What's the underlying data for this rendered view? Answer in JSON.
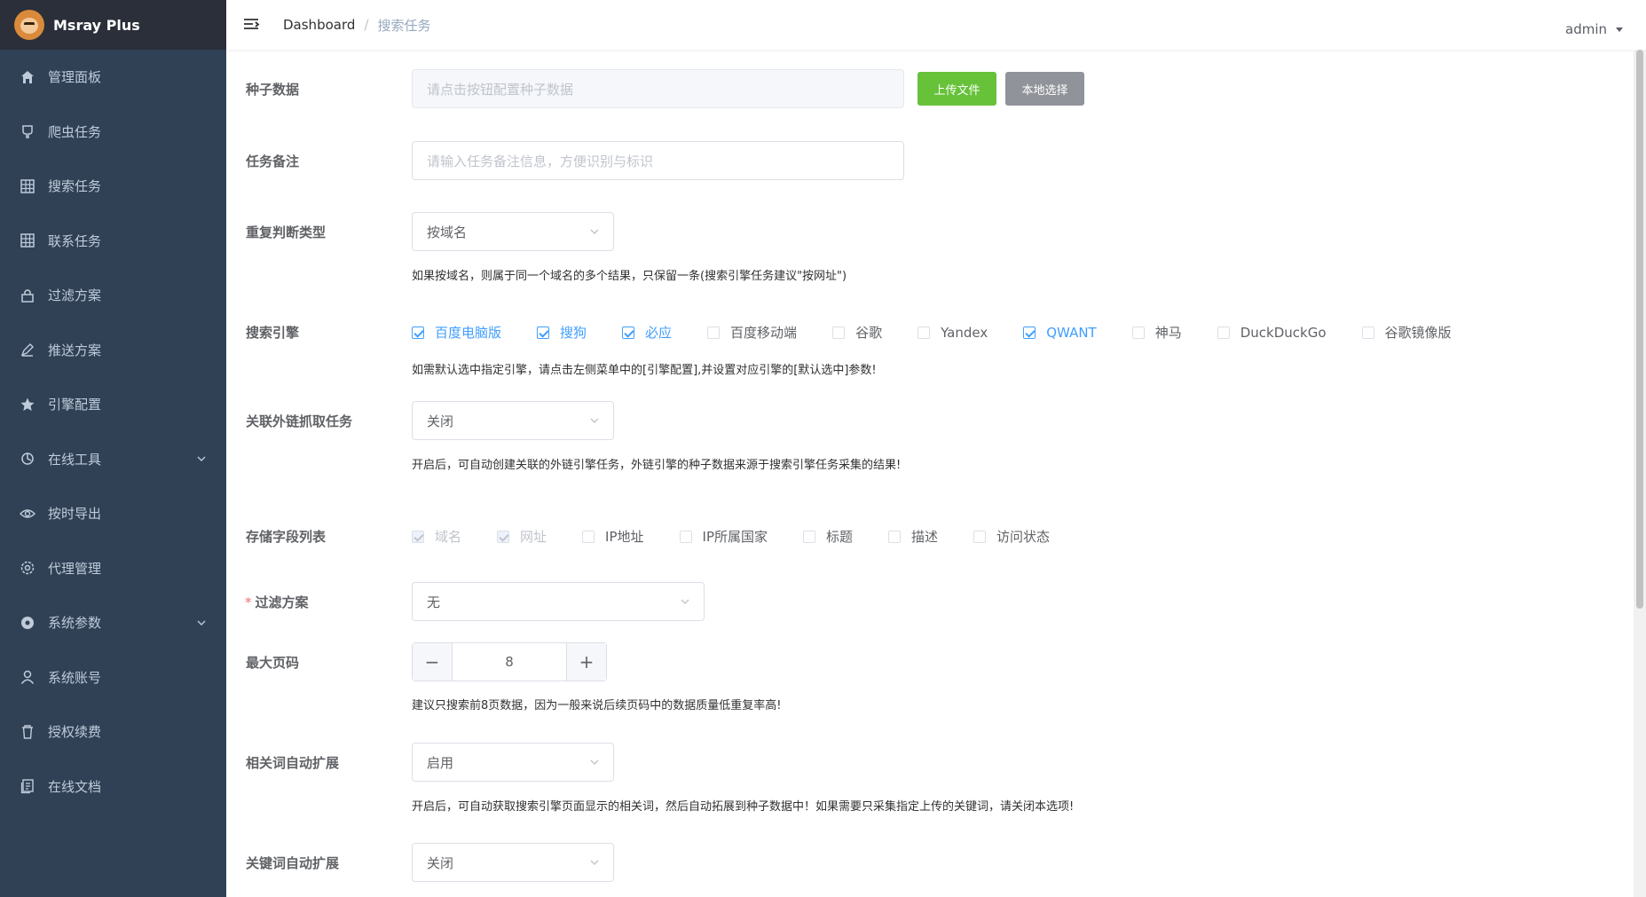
{
  "app": {
    "title": "Msray Plus"
  },
  "sidebar": {
    "items": [
      {
        "label": "管理面板",
        "icon": "home-icon"
      },
      {
        "label": "爬虫任务",
        "icon": "spider-icon"
      },
      {
        "label": "搜索任务",
        "icon": "table-icon"
      },
      {
        "label": "联系任务",
        "icon": "table-icon"
      },
      {
        "label": "过滤方案",
        "icon": "lock-icon"
      },
      {
        "label": "推送方案",
        "icon": "edit-icon"
      },
      {
        "label": "引擎配置",
        "icon": "star-icon"
      },
      {
        "label": "在线工具",
        "icon": "tools-icon",
        "expandable": true
      },
      {
        "label": "按时导出",
        "icon": "eye-icon"
      },
      {
        "label": "代理管理",
        "icon": "gear-outline-icon"
      },
      {
        "label": "系统参数",
        "icon": "gear-icon",
        "expandable": true
      },
      {
        "label": "系统账号",
        "icon": "user-icon"
      },
      {
        "label": "授权续费",
        "icon": "trash-icon"
      },
      {
        "label": "在线文档",
        "icon": "document-icon"
      }
    ]
  },
  "header": {
    "breadcrumb": [
      "Dashboard",
      "搜索任务"
    ],
    "user": "admin"
  },
  "form": {
    "seed": {
      "label": "种子数据",
      "placeholder": "请点击按钮配置种子数据",
      "upload_btn": "上传文件",
      "local_btn": "本地选择"
    },
    "note": {
      "label": "任务备注",
      "placeholder": "请输入任务备注信息，方便识别与标识"
    },
    "dedupe": {
      "label": "重复判断类型",
      "value": "按域名",
      "hint": "如果按域名，则属于同一个域名的多个结果，只保留一条(搜索引擎任务建议\"按网址\")"
    },
    "engines": {
      "label": "搜索引擎",
      "options": [
        {
          "label": "百度电脑版",
          "checked": true
        },
        {
          "label": "搜狗",
          "checked": true
        },
        {
          "label": "必应",
          "checked": true
        },
        {
          "label": "百度移动端",
          "checked": false
        },
        {
          "label": "谷歌",
          "checked": false
        },
        {
          "label": "Yandex",
          "checked": false
        },
        {
          "label": "QWANT",
          "checked": true
        },
        {
          "label": "神马",
          "checked": false
        },
        {
          "label": "DuckDuckGo",
          "checked": false
        },
        {
          "label": "谷歌镜像版",
          "checked": false
        }
      ],
      "hint": "如需默认选中指定引擎，请点击左侧菜单中的[引擎配置],并设置对应引擎的[默认选中]参数!"
    },
    "linked": {
      "label": "关联外链抓取任务",
      "value": "关闭",
      "hint": "开启后，可自动创建关联的外链引擎任务，外链引擎的种子数据来源于搜索引擎任务采集的结果!"
    },
    "fields": {
      "label": "存储字段列表",
      "options": [
        {
          "label": "域名",
          "state": "disabled-checked"
        },
        {
          "label": "网址",
          "state": "disabled-checked"
        },
        {
          "label": "IP地址",
          "state": "unchecked"
        },
        {
          "label": "IP所属国家",
          "state": "unchecked"
        },
        {
          "label": "标题",
          "state": "unchecked"
        },
        {
          "label": "描述",
          "state": "unchecked"
        },
        {
          "label": "访问状态",
          "state": "unchecked"
        }
      ]
    },
    "filter": {
      "required_mark": "*",
      "label": "过滤方案",
      "value": "无"
    },
    "maxpage": {
      "label": "最大页码",
      "value": "8",
      "minus": "−",
      "plus": "+",
      "hint": "建议只搜索前8页数据，因为一般来说后续页码中的数据质量低重复率高!"
    },
    "related": {
      "label": "相关词自动扩展",
      "value": "启用",
      "hint": "开启后，可自动获取搜索引擎页面显示的相关词，然后自动拓展到种子数据中！如果需要只采集指定上传的关键词，请关闭本选项!"
    },
    "keyword": {
      "label": "关键词自动扩展",
      "value": "关闭"
    }
  },
  "colors": {
    "sidebar": "#304156",
    "brand_bar": "#2b2f3a",
    "primary": "#409eff",
    "success": "#67c23a",
    "info": "#909399"
  }
}
